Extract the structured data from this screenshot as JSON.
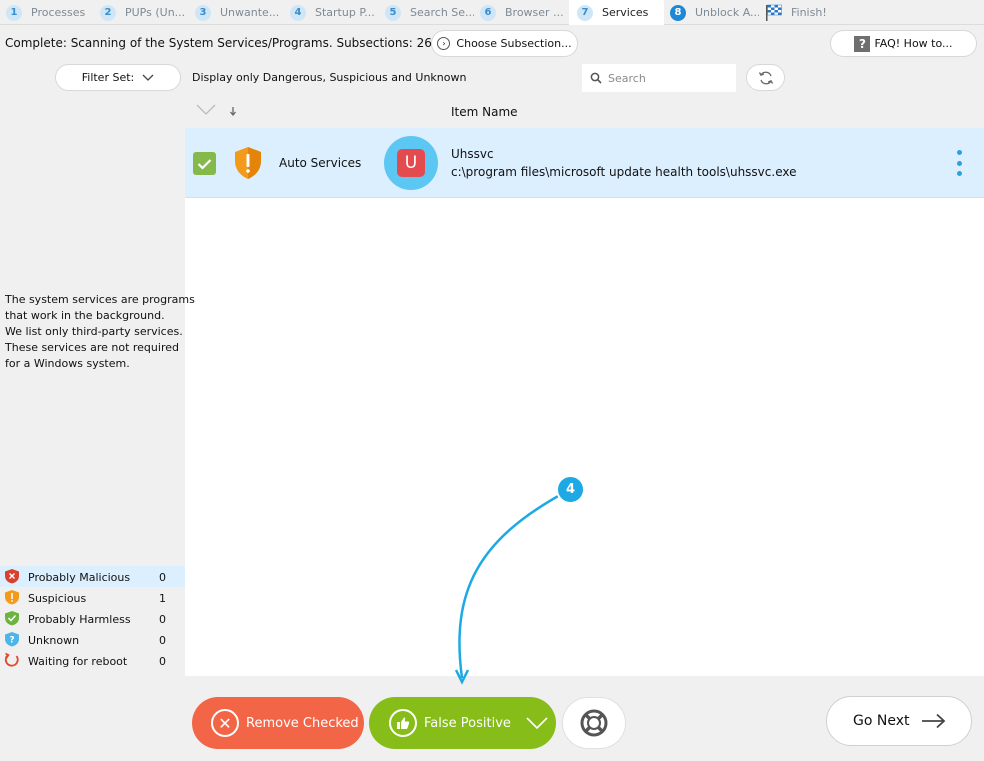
{
  "tabs": [
    {
      "num": "1",
      "label": "Processes"
    },
    {
      "num": "2",
      "label": "PUPs (Un..."
    },
    {
      "num": "3",
      "label": "Unwante..."
    },
    {
      "num": "4",
      "label": "Startup P..."
    },
    {
      "num": "5",
      "label": "Search Se..."
    },
    {
      "num": "6",
      "label": "Browser ..."
    },
    {
      "num": "7",
      "label": "Services"
    },
    {
      "num": "8",
      "label": "Unblock A..."
    },
    {
      "num": "",
      "label": "Finish!"
    }
  ],
  "topbar": {
    "status": "Complete: Scanning of the System Services/Programs. Subsections: 26",
    "choose_label": "Choose Subsection...",
    "faq_label": "FAQ! How to..."
  },
  "filter": {
    "label": "Filter Set:",
    "description": "Display only Dangerous, Suspicious and Unknown"
  },
  "search": {
    "placeholder": "Search",
    "value": ""
  },
  "columns": {
    "item_name": "Item Name"
  },
  "rows": [
    {
      "type": "Auto Services",
      "app_letter": "U",
      "name": "Uhssvc",
      "path": "c:\\program files\\microsoft update health tools\\uhssvc.exe",
      "checked": true
    }
  ],
  "description": [
    "The system services are programs",
    "that work in the background.",
    "We list only third-party services.",
    "These services are not required",
    "for a Windows system."
  ],
  "legend": [
    {
      "label": "Probably Malicious",
      "count": "0",
      "icon": "malicious-shield-icon",
      "color": "#d9412d"
    },
    {
      "label": "Suspicious",
      "count": "1",
      "icon": "suspicious-shield-icon",
      "color": "#f39a1b"
    },
    {
      "label": "Probably Harmless",
      "count": "0",
      "icon": "harmless-shield-icon",
      "color": "#6db33f"
    },
    {
      "label": "Unknown",
      "count": "0",
      "icon": "unknown-shield-icon",
      "color": "#4db6e8"
    },
    {
      "label": "Waiting for reboot",
      "count": "0",
      "icon": "reboot-icon",
      "color": "#e0492e"
    }
  ],
  "buttons": {
    "remove": "Remove Checked",
    "false_positive": "False Positive",
    "go_next": "Go Next"
  },
  "annotation": {
    "step": "4"
  },
  "colors": {
    "accent": "#1e88d5",
    "remove": "#f26647",
    "false_positive": "#86bd19",
    "row_highlight": "#dcefff"
  }
}
